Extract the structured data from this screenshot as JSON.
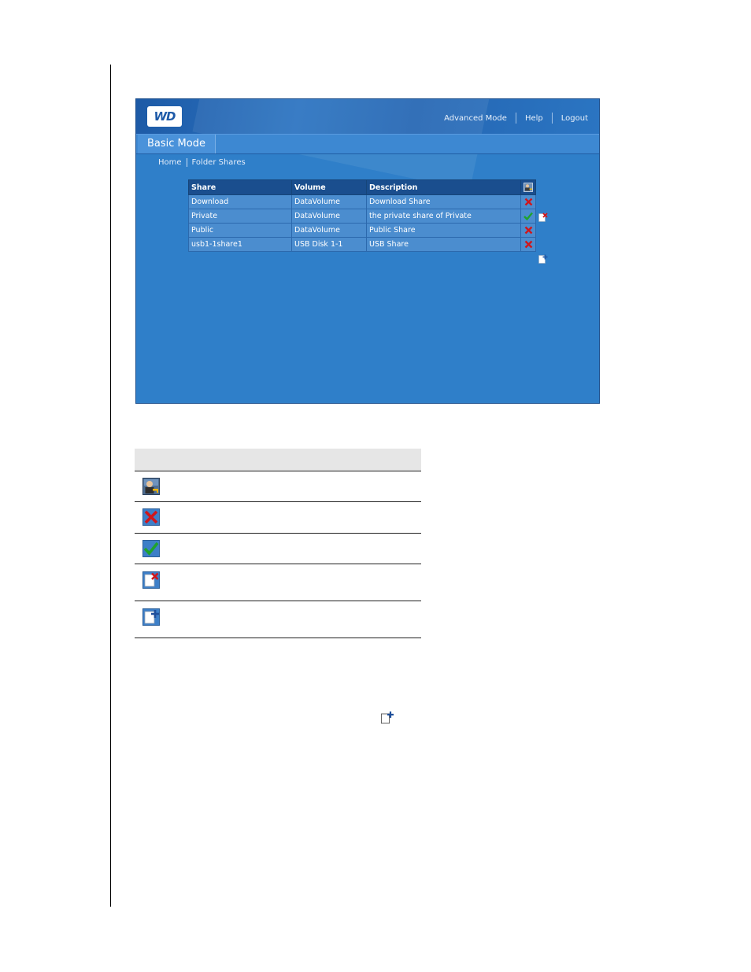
{
  "app": {
    "logo_text": "WD",
    "top_nav": [
      "Advanced Mode",
      "Help",
      "Logout"
    ],
    "mode_tab": "Basic Mode",
    "breadcrumb": [
      "Home",
      "Folder Shares"
    ]
  },
  "shares_table": {
    "columns": [
      "Share",
      "Volume",
      "Description"
    ],
    "header_icon": "user-key-icon",
    "rows": [
      {
        "share": "Download",
        "volume": "DataVolume",
        "description": "Download Share",
        "status_icon": "x-icon"
      },
      {
        "share": "Private",
        "volume": "DataVolume",
        "description": "the private share of Private",
        "status_icon": "check-icon"
      },
      {
        "share": "Public",
        "volume": "DataVolume",
        "description": "Public Share",
        "status_icon": "x-icon"
      },
      {
        "share": "usb1-1share1",
        "volume": "USB Disk 1-1",
        "description": "USB Share",
        "status_icon": "x-icon"
      }
    ],
    "row_action_icon": "delete-share-icon",
    "add_icon": "add-share-icon"
  },
  "legend": {
    "icons": [
      "user-key-icon",
      "x-icon",
      "check-icon",
      "delete-share-icon",
      "add-share-icon"
    ]
  },
  "colors": {
    "app_bg": "#2f7fc9",
    "header_dark": "#1a4e8e",
    "row_bg": "#4b8dcf",
    "x_red": "#d0161b",
    "check_green": "#1fa32e"
  }
}
